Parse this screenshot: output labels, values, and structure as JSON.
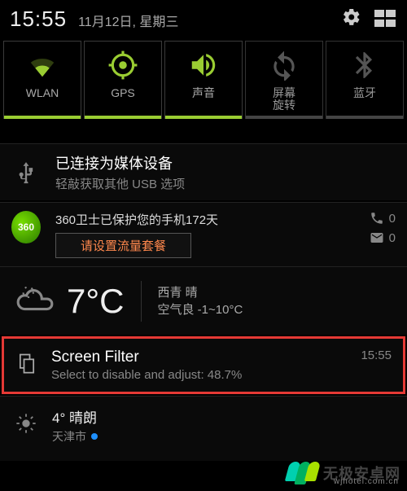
{
  "statusbar": {
    "time": "15:55",
    "date": "11月12日, 星期三"
  },
  "tiles": [
    {
      "label": "WLAN",
      "active": true
    },
    {
      "label": "GPS",
      "active": true
    },
    {
      "label": "声音",
      "active": true
    },
    {
      "label": "屏幕\n旋转",
      "active": false
    },
    {
      "label": "蓝牙",
      "active": false
    }
  ],
  "usb": {
    "title": "已连接为媒体设备",
    "sub": "轻敲获取其他 USB 选项"
  },
  "guard": {
    "title": "360卫士已保护您的手机172天",
    "button": "请设置流量套餐",
    "missed_calls": "0",
    "missed_msgs": "0"
  },
  "weather": {
    "temp": "7°C",
    "line1": "西青 晴",
    "line2": "空气良 -1~10°C"
  },
  "screenfilter": {
    "title": "Screen Filter",
    "sub": "Select to disable and adjust: 48.7%",
    "time": "15:55"
  },
  "miniweather": {
    "title": "4° 晴朗",
    "city": "天津市"
  },
  "watermark": {
    "title": "无极安卓网",
    "url": "wjhotel.com.cn"
  }
}
